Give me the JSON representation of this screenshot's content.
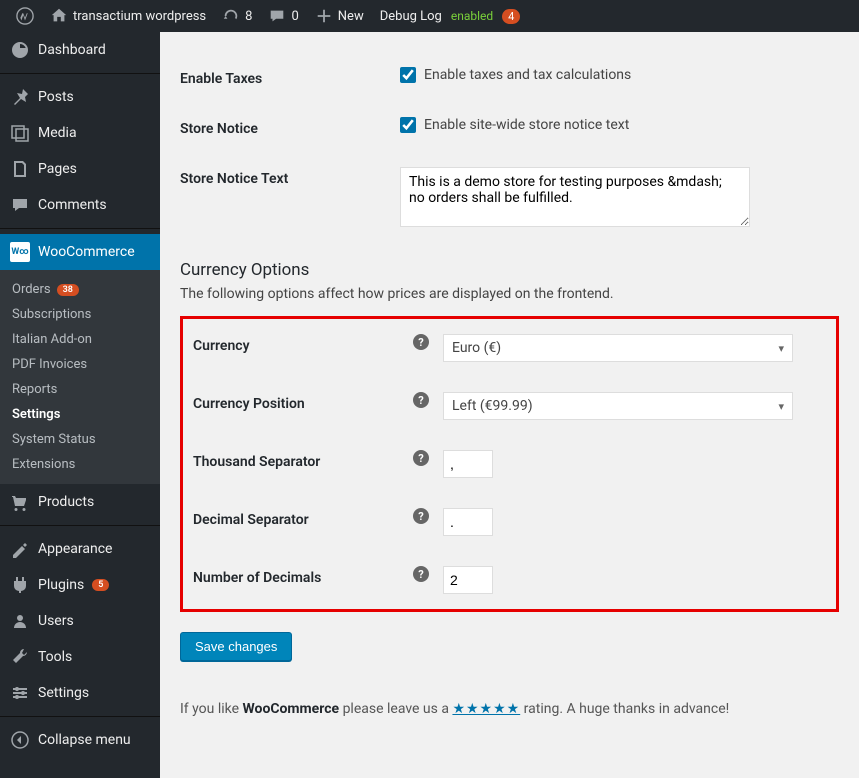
{
  "toolbar": {
    "site_name": "transactium wordpress",
    "updates_count": "8",
    "comments_count": "0",
    "new_label": "New",
    "debug_label": "Debug Log",
    "debug_status": "enabled",
    "debug_count": "4"
  },
  "sidebar": {
    "dashboard": "Dashboard",
    "posts": "Posts",
    "media": "Media",
    "pages": "Pages",
    "comments": "Comments",
    "woocommerce": "WooCommerce",
    "products": "Products",
    "appearance": "Appearance",
    "plugins": "Plugins",
    "plugins_count": "5",
    "users": "Users",
    "tools": "Tools",
    "settings": "Settings",
    "collapse": "Collapse menu",
    "sub": {
      "orders": "Orders",
      "orders_count": "38",
      "subscriptions": "Subscriptions",
      "italian": "Italian Add-on",
      "pdf": "PDF Invoices",
      "reports": "Reports",
      "settings": "Settings",
      "status": "System Status",
      "extensions": "Extensions"
    }
  },
  "form": {
    "enable_taxes_label": "Enable Taxes",
    "enable_taxes_desc": "Enable taxes and tax calculations",
    "store_notice_label": "Store Notice",
    "store_notice_desc": "Enable site-wide store notice text",
    "store_notice_text_label": "Store Notice Text",
    "store_notice_text_value": "This is a demo store for testing purposes &mdash; no orders shall be fulfilled.",
    "currency_heading": "Currency Options",
    "currency_subhead": "The following options affect how prices are displayed on the frontend.",
    "currency_label": "Currency",
    "currency_value": "Euro (€)",
    "currency_pos_label": "Currency Position",
    "currency_pos_value": "Left (€99.99)",
    "thousand_sep_label": "Thousand Separator",
    "thousand_sep_value": ",",
    "decimal_sep_label": "Decimal Separator",
    "decimal_sep_value": ".",
    "num_decimals_label": "Number of Decimals",
    "num_decimals_value": "2",
    "save_button": "Save changes"
  },
  "footer": {
    "prefix": "If you like ",
    "product": "WooCommerce",
    "mid": " please leave us a ",
    "stars": "★★★★★",
    "suffix": " rating. A huge thanks in advance!"
  }
}
